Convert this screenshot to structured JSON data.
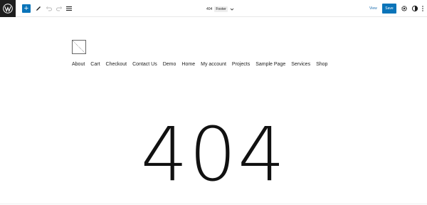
{
  "topbar": {
    "add_label": "+",
    "document": {
      "name": "404",
      "type": "Footer"
    },
    "view_label": "View",
    "save_label": "Save"
  },
  "site": {
    "nav": [
      "About",
      "Cart",
      "Checkout",
      "Contact Us",
      "Demo",
      "Home",
      "My account",
      "Projects",
      "Sample Page",
      "Services",
      "Shop"
    ],
    "hero_text": "404"
  },
  "colors": {
    "accent": "#0a74b9",
    "logo_bg": "#1e1e1e"
  },
  "icons": [
    "wordpress-logo-icon",
    "plus-icon",
    "pencil-icon",
    "undo-icon",
    "redo-icon",
    "list-view-icon",
    "chevron-down-icon",
    "gear-icon",
    "half-circle-icon",
    "more-vertical-icon",
    "site-logo-placeholder-icon"
  ]
}
